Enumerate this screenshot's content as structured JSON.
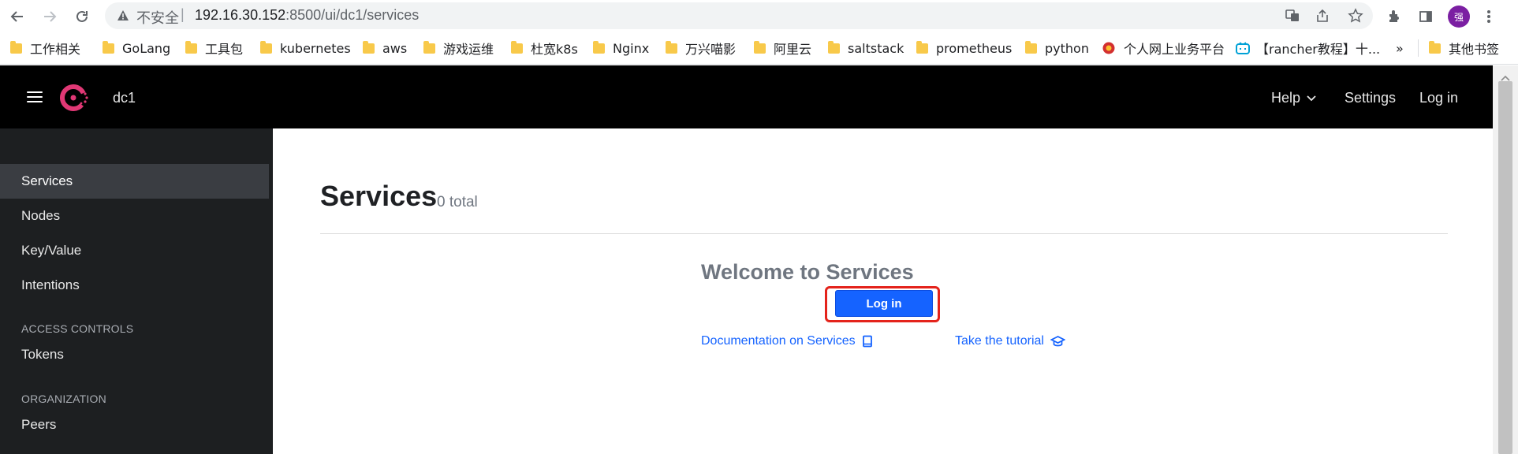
{
  "browser": {
    "insecure_label": "不安全",
    "separator": "|",
    "url_host": "192.16.30.152",
    "url_path": ":8500/ui/dc1/services",
    "avatar_text": "强",
    "bookmarks": [
      {
        "label": "工作相关"
      },
      {
        "label": "GoLang"
      },
      {
        "label": "工具包"
      },
      {
        "label": "kubernetes"
      },
      {
        "label": "aws"
      },
      {
        "label": "游戏运维"
      },
      {
        "label": "杜宽k8s"
      },
      {
        "label": "Nginx"
      },
      {
        "label": "万兴喵影"
      },
      {
        "label": "阿里云"
      },
      {
        "label": "saltstack"
      },
      {
        "label": "prometheus"
      },
      {
        "label": "python"
      },
      {
        "label": "个人网上业务平台"
      },
      {
        "label": "【rancher教程】十..."
      },
      {
        "label": "»"
      },
      {
        "label": "其他书签"
      }
    ]
  },
  "app": {
    "datacenter": "dc1",
    "nav": {
      "help": "Help",
      "settings": "Settings",
      "login": "Log in"
    },
    "sidebar": {
      "items": [
        {
          "label": "Services",
          "active": true
        },
        {
          "label": "Nodes"
        },
        {
          "label": "Key/Value"
        },
        {
          "label": "Intentions"
        }
      ],
      "access_controls_heading": "ACCESS CONTROLS",
      "access_items": [
        {
          "label": "Tokens"
        }
      ],
      "organization_heading": "ORGANIZATION",
      "organization_items": [
        {
          "label": "Peers"
        }
      ]
    },
    "main": {
      "title": "Services",
      "count": "0 total",
      "welcome": "Welcome to Services",
      "login_button": "Log in",
      "doc_link": "Documentation on Services",
      "tutorial_link": "Take the tutorial"
    }
  },
  "colors": {
    "consul_brand": "#e03875",
    "primary_blue": "#1563ff",
    "highlight_red": "#e4231b",
    "sidebar_bg": "#1d1f21"
  }
}
